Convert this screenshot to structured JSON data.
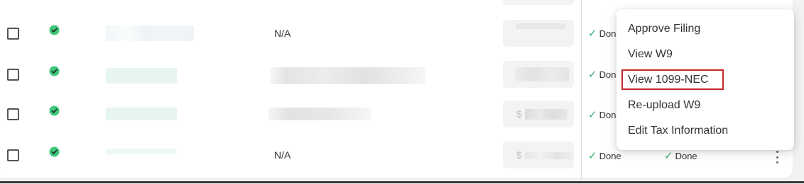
{
  "colors": {
    "verified_green": "#3ec67b",
    "done_green": "#3cae6a",
    "highlight_red": "#c62828"
  },
  "icons": {
    "verified": "check-circle-icon",
    "done": "checkmark-icon",
    "more": "kebab-vertical-icon"
  },
  "rows": [
    {
      "address": "N/A",
      "amount_prefix": "",
      "status_1": "Done",
      "status_2": ""
    },
    {
      "address": "",
      "amount_prefix": "",
      "status_1": "Done",
      "status_2": ""
    },
    {
      "address": "",
      "amount_prefix": "$",
      "status_1": "Done",
      "status_2": ""
    },
    {
      "address": "N/A",
      "amount_prefix": "$",
      "status_1": "Done",
      "status_2": "Done"
    }
  ],
  "menu": {
    "items": [
      {
        "label": "Approve Filing"
      },
      {
        "label": "View W9"
      },
      {
        "label": "View 1099-NEC"
      },
      {
        "label": "Re-upload W9"
      },
      {
        "label": "Edit Tax Information"
      }
    ]
  }
}
